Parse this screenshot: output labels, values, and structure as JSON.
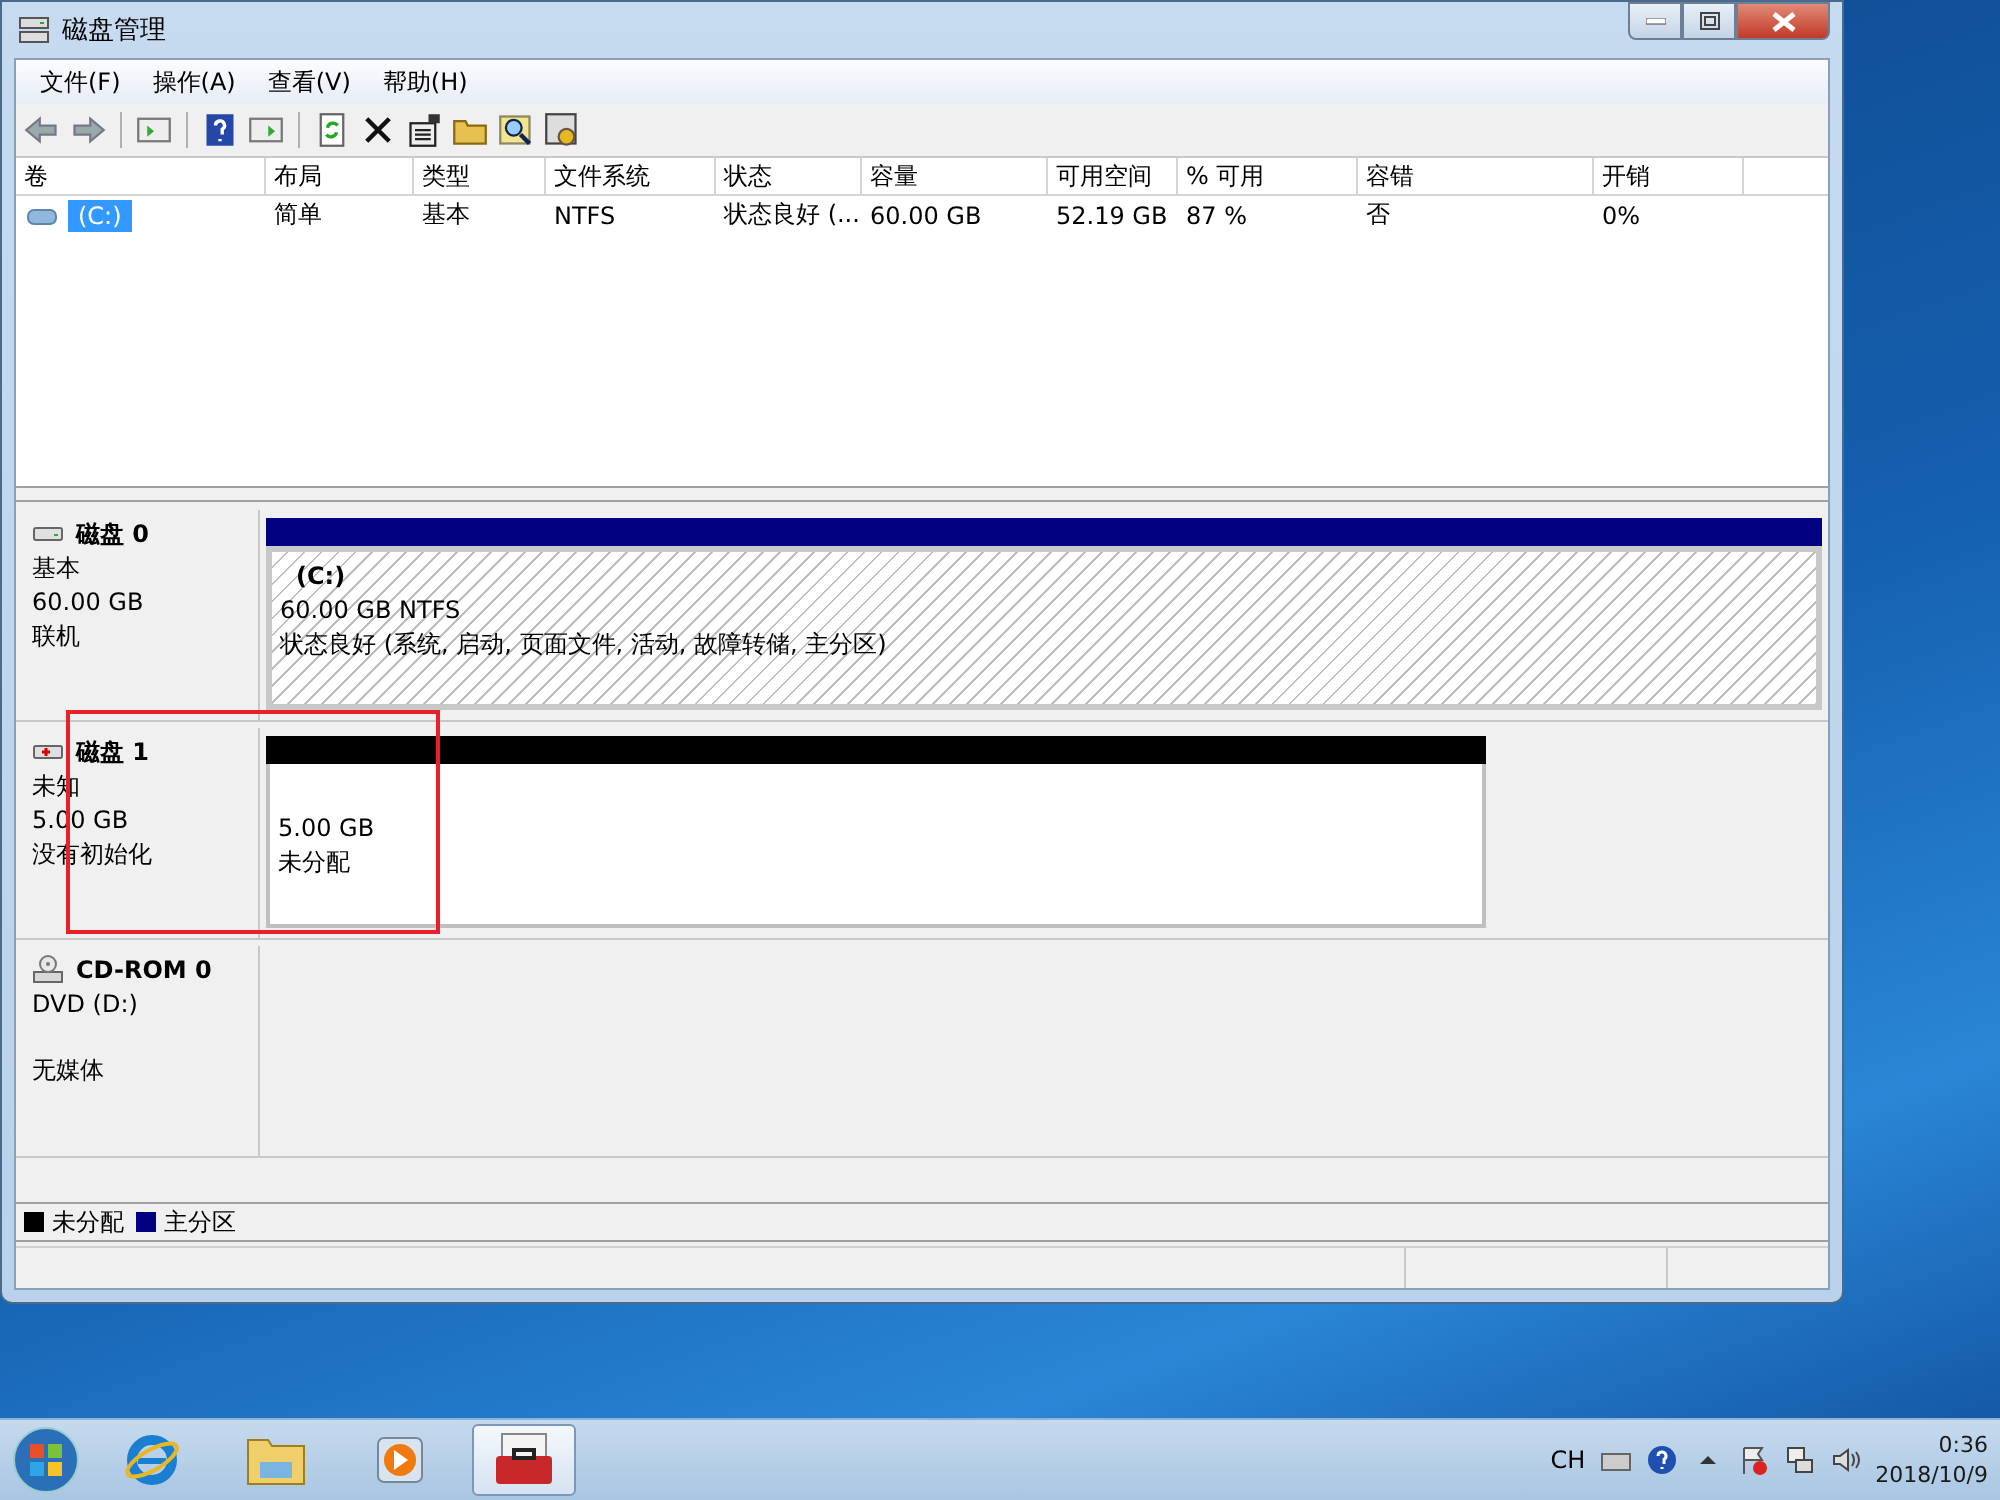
{
  "window": {
    "title": "磁盘管理"
  },
  "menu": [
    "文件(F)",
    "操作(A)",
    "查看(V)",
    "帮助(H)"
  ],
  "volume_table": {
    "columns": [
      "卷",
      "布局",
      "类型",
      "文件系统",
      "状态",
      "容量",
      "可用空间",
      "% 可用",
      "容错",
      "开销"
    ],
    "rows": [
      {
        "selected": true,
        "cells": [
          "(C:)",
          "简单",
          "基本",
          "NTFS",
          "状态良好 (...",
          "60.00 GB",
          "52.19 GB",
          "87 %",
          "否",
          "0%"
        ]
      }
    ]
  },
  "disks": [
    {
      "kind": "disk",
      "name": "磁盘 0",
      "details": [
        "基本",
        "60.00 GB",
        "联机"
      ],
      "partitions": [
        {
          "kind": "primary",
          "label": "(C:)",
          "lines": [
            "60.00 GB NTFS",
            "状态良好 (系统, 启动, 页面文件, 活动, 故障转储, 主分区)"
          ]
        }
      ]
    },
    {
      "kind": "uninitialized",
      "name": "磁盘 1",
      "details": [
        "未知",
        "5.00 GB",
        "没有初始化"
      ],
      "partitions": [
        {
          "kind": "unallocated",
          "lines": [
            "5.00 GB",
            "未分配"
          ]
        }
      ]
    },
    {
      "kind": "cdrom",
      "name": "CD-ROM 0",
      "details": [
        "DVD (D:)",
        "无媒体"
      ]
    }
  ],
  "legend": [
    {
      "label": "未分配",
      "color": "#000000"
    },
    {
      "label": "主分区",
      "color": "#000080"
    }
  ],
  "taskbar": {
    "tray_language": "CH",
    "time": "0:36",
    "date": "2018/10/9"
  }
}
